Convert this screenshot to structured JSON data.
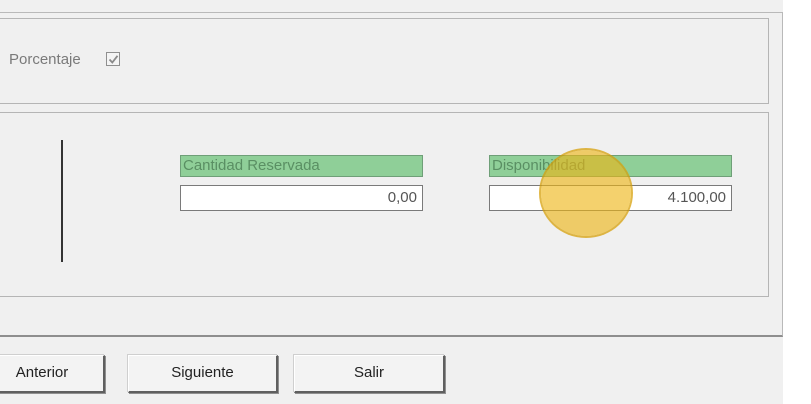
{
  "options": {
    "percentage_label": "Porcentaje",
    "percentage_checked": true
  },
  "fields": {
    "reserved_label": "Cantidad Reservada",
    "reserved_value": "0,00",
    "availability_label": "Disponibilidad",
    "availability_value": "4.100,00"
  },
  "buttons": {
    "previous_label": "Anterior",
    "next_label": "Siguiente",
    "exit_label": "Salir"
  },
  "colors": {
    "label_background": "#8fcf98",
    "cursor_highlight": "#eeb414"
  }
}
